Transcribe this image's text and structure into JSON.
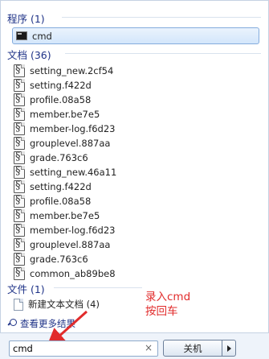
{
  "programs": {
    "header": "程序 (1)",
    "items": [
      {
        "label": "cmd",
        "icon": "cmd-icon"
      }
    ]
  },
  "documents": {
    "header": "文档 (36)",
    "items": [
      {
        "label": "setting_new.2cf54",
        "icon": "document-icon"
      },
      {
        "label": "setting.f422d",
        "icon": "document-icon"
      },
      {
        "label": "profile.08a58",
        "icon": "document-icon"
      },
      {
        "label": "member.be7e5",
        "icon": "document-icon"
      },
      {
        "label": "member-log.f6d23",
        "icon": "document-icon"
      },
      {
        "label": "grouplevel.887aa",
        "icon": "document-icon"
      },
      {
        "label": "grade.763c6",
        "icon": "document-icon"
      },
      {
        "label": "setting_new.46a11",
        "icon": "document-icon"
      },
      {
        "label": "setting.f422d",
        "icon": "document-icon"
      },
      {
        "label": "profile.08a58",
        "icon": "document-icon"
      },
      {
        "label": "member.be7e5",
        "icon": "document-icon"
      },
      {
        "label": "member-log.f6d23",
        "icon": "document-icon"
      },
      {
        "label": "grouplevel.887aa",
        "icon": "document-icon"
      },
      {
        "label": "grade.763c6",
        "icon": "document-icon"
      },
      {
        "label": "common_ab89be8",
        "icon": "document-icon"
      }
    ]
  },
  "files": {
    "header": "文件 (1)",
    "items": [
      {
        "label": "新建文本文档 (4)",
        "icon": "text-file-icon"
      }
    ]
  },
  "more_results": "查看更多结果",
  "annotation": {
    "line1": "录入cmd",
    "line2": "按回车",
    "color": "#e12b2b"
  },
  "search": {
    "value": "cmd",
    "clear_glyph": "×"
  },
  "shutdown": {
    "label": "关机"
  }
}
